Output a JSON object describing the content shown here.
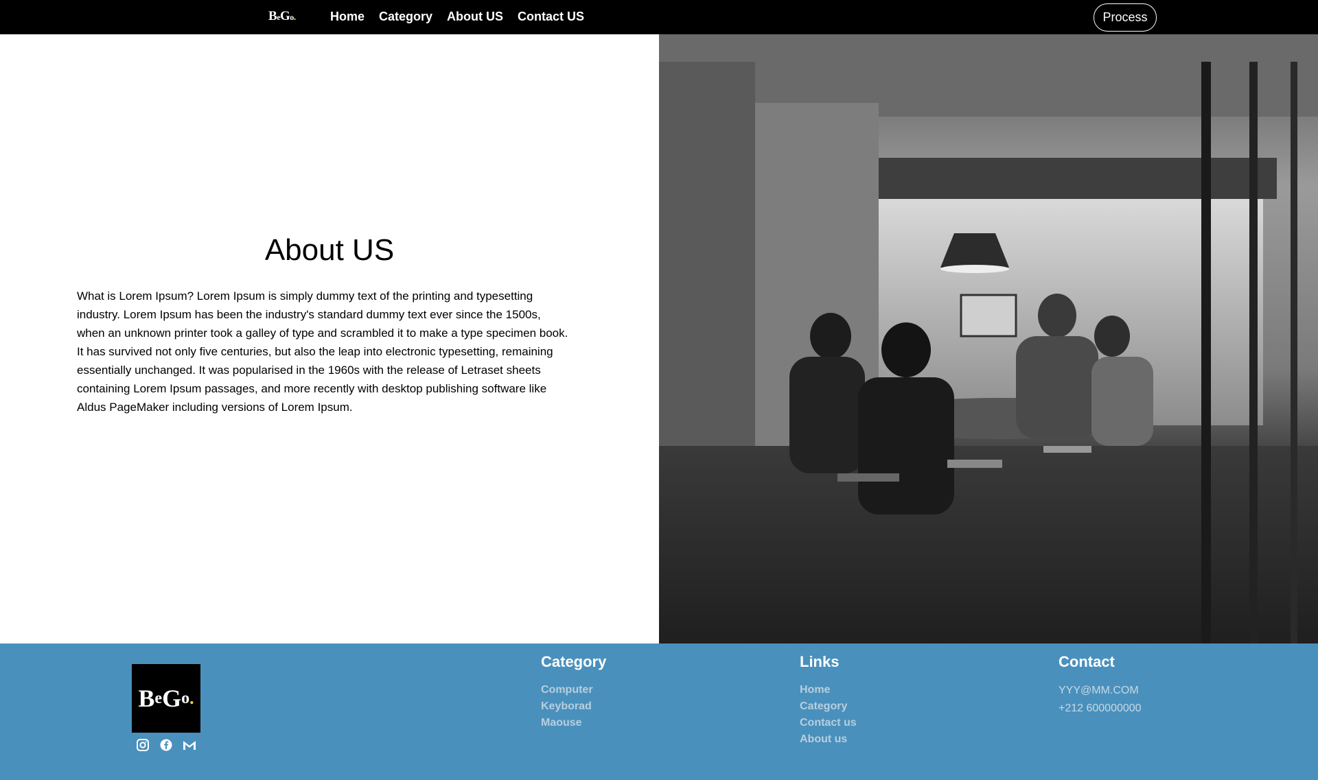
{
  "nav": {
    "logo_big_b": "B",
    "logo_small_e": "e",
    "logo_big_g": "G",
    "logo_small_o": "o",
    "logo_dot": ".",
    "links": [
      "Home",
      "Category",
      "About US",
      "Contact US"
    ],
    "process_label": "Process"
  },
  "about": {
    "title": "About US",
    "text": "What is Lorem Ipsum? Lorem Ipsum is simply dummy text of the printing and typesetting industry. Lorem Ipsum has been the industry's standard dummy text ever since the 1500s, when an unknown printer took a galley of type and scrambled it to make a type specimen book. It has survived not only five centuries, but also the leap into electronic typesetting, remaining essentially unchanged. It was popularised in the 1960s with the release of Letraset sheets containing Lorem Ipsum passages, and more recently with desktop publishing software like Aldus PageMaker including versions of Lorem Ipsum."
  },
  "footer": {
    "logo_big_b": "B",
    "logo_small_e": "e",
    "logo_big_g": "G",
    "logo_small_o": "o",
    "logo_dot": ".",
    "social_icons": [
      "instagram-icon",
      "facebook-icon",
      "gmail-icon"
    ],
    "category": {
      "title": "Category",
      "items": [
        "Computer",
        "Keyborad",
        "Maouse"
      ]
    },
    "links": {
      "title": "Links",
      "items": [
        "Home",
        "Category",
        "Contact us",
        "About us"
      ]
    },
    "contact": {
      "title": "Contact",
      "email": "YYY@MM.COM",
      "phone": "+212 600000000"
    }
  },
  "colors": {
    "nav_bg": "#000000",
    "footer_bg": "#4a90bd",
    "logo_accent": "#f5d13a"
  }
}
